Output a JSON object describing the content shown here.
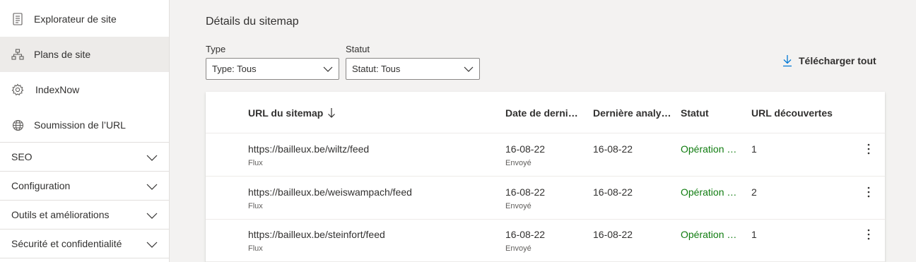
{
  "sidebar": {
    "items": [
      {
        "label": "Explorateur de site",
        "icon": "document-list-icon"
      },
      {
        "label": "Plans de site",
        "icon": "sitemap-icon",
        "active": true
      },
      {
        "label": "IndexNow",
        "icon": "gear-icon"
      },
      {
        "label": "Soumission de l’URL",
        "icon": "globe-icon"
      }
    ],
    "groups": [
      {
        "label": "SEO"
      },
      {
        "label": "Configuration"
      },
      {
        "label": "Outils et améliorations"
      },
      {
        "label": "Sécurité et confidentialité"
      }
    ]
  },
  "main": {
    "title": "Détails du sitemap",
    "filters": {
      "type": {
        "label": "Type",
        "value": "Type: Tous"
      },
      "status": {
        "label": "Statut",
        "value": "Statut: Tous"
      }
    },
    "download_label": "Télécharger tout",
    "table": {
      "columns": [
        "URL du sitemap",
        "Date de derni…",
        "Dernière analy…",
        "Statut",
        "URL découvertes"
      ],
      "rows": [
        {
          "url": "https://bailleux.be/wiltz/feed",
          "type": "Flux",
          "date": "16-08-22",
          "date_sub": "Envoyé",
          "last_crawl": "16-08-22",
          "status": "Opération …",
          "discovered": "1"
        },
        {
          "url": "https://bailleux.be/weiswampach/feed",
          "type": "Flux",
          "date": "16-08-22",
          "date_sub": "Envoyé",
          "last_crawl": "16-08-22",
          "status": "Opération …",
          "discovered": "2"
        },
        {
          "url": "https://bailleux.be/steinfort/feed",
          "type": "Flux",
          "date": "16-08-22",
          "date_sub": "Envoyé",
          "last_crawl": "16-08-22",
          "status": "Opération …",
          "discovered": "1"
        }
      ]
    }
  },
  "colors": {
    "accent": "#0078d4",
    "success": "#107c10",
    "active_bg": "#edebe9"
  }
}
